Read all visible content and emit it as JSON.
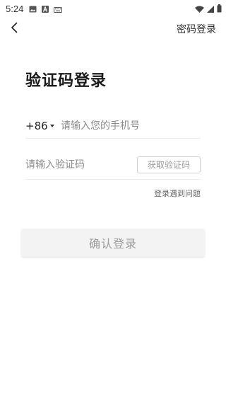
{
  "status_bar": {
    "time": "5:24",
    "icons": [
      "image-icon",
      "a-letter-icon",
      "keyboard-icon",
      "wifi-icon",
      "signal-icon",
      "battery-icon"
    ]
  },
  "app_bar": {
    "back_icon": "chevron-left-icon",
    "password_login_label": "密码登录"
  },
  "page": {
    "title": "验证码登录"
  },
  "phone": {
    "country_code": "+86",
    "placeholder": "请输入您的手机号",
    "value": ""
  },
  "code": {
    "placeholder": "请输入验证码",
    "value": "",
    "get_code_label": "获取验证码"
  },
  "help_link": "登录遇到问题",
  "confirm_button": "确认登录",
  "colors": {
    "text_primary": "#1a1a1a",
    "placeholder": "#8a8a8a",
    "divider": "#ececec",
    "button_disabled_bg": "#f3f3f3",
    "button_disabled_text": "#9b9b9b"
  }
}
